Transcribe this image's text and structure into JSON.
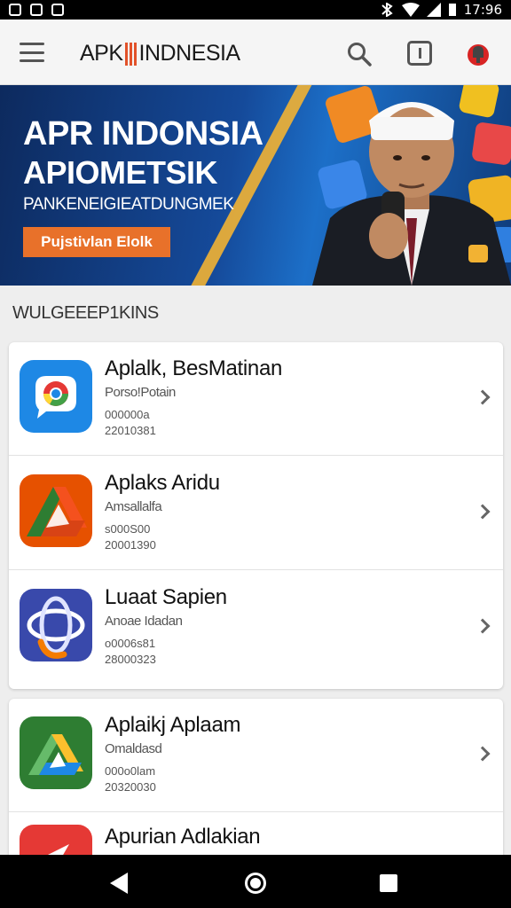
{
  "status_bar": {
    "time": "17:96"
  },
  "header": {
    "brand_left": "APK",
    "brand_right": "INDNESIA"
  },
  "banner": {
    "title_line1": "APR INDONSIA",
    "title_line2": "APIOMETSIK",
    "subtitle": "PANKENEIGIEATDUNGMEK",
    "cta_label": "Pujstivlan Elolk"
  },
  "section": {
    "title": "WULGEEEP1KINS"
  },
  "apps": [
    {
      "title": "Aplalk, BesMatinan",
      "subtitle": "Porso!Potain",
      "meta1": "000000a",
      "meta2": "22010381",
      "icon": "chrome-style-app-icon"
    },
    {
      "title": "Aplaks Aridu",
      "subtitle": "Amsallalfa",
      "meta1": "s000S00",
      "meta2": "20001390",
      "icon": "drive-style-app-icon"
    },
    {
      "title": "Luaat Sapien",
      "subtitle": "Anoae Idadan",
      "meta1": "o0006s81",
      "meta2": "28000323",
      "icon": "orbit-app-icon"
    },
    {
      "title": "Aplaikj Aplaam",
      "subtitle": "Omaldasd",
      "meta1": "000o0lam",
      "meta2": "20320030",
      "icon": "triangle-app-icon"
    },
    {
      "title": "Apurian Adlakian",
      "icon": "red-app-icon"
    }
  ],
  "colors": {
    "accent": "#e8712a",
    "banner_blue": "#154a9a",
    "brand_mark": "#e2522a"
  }
}
